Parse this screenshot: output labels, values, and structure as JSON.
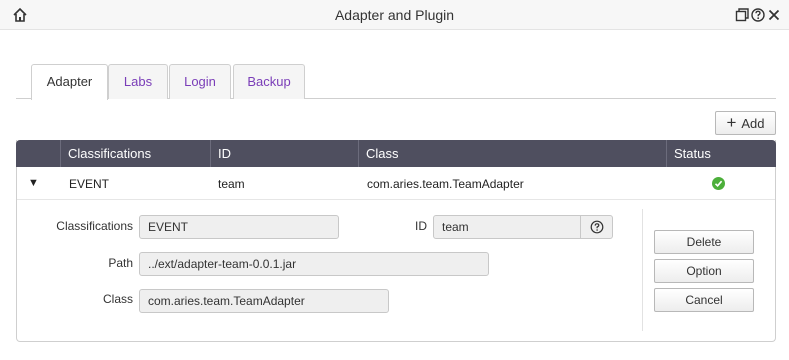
{
  "window": {
    "title": "Adapter and Plugin",
    "icons": [
      "home-icon",
      "restore-icon",
      "help-icon",
      "close-icon"
    ]
  },
  "tabs": [
    {
      "label": "Adapter",
      "active": true
    },
    {
      "label": "Labs",
      "active": false
    },
    {
      "label": "Login",
      "active": false
    },
    {
      "label": "Backup",
      "active": false
    }
  ],
  "toolbar": {
    "add_label": "Add"
  },
  "table": {
    "columns": [
      "Classifications",
      "ID",
      "Class",
      "Status"
    ],
    "rows": [
      {
        "classification": "EVENT",
        "id": "team",
        "class": "com.aries.team.TeamAdapter",
        "status": "ok",
        "expanded": true
      }
    ]
  },
  "detail": {
    "classifications_label": "Classifications",
    "classifications_value": "EVENT",
    "id_label": "ID",
    "id_value": "team",
    "path_label": "Path",
    "path_value": "../ext/adapter-team-0.0.1.jar",
    "class_label": "Class",
    "class_value": "com.aries.team.TeamAdapter",
    "buttons": {
      "delete": "Delete",
      "option": "Option",
      "cancel": "Cancel"
    }
  },
  "colors": {
    "header_bg": "#4f4f5f",
    "tab_inactive_text": "#7a3db8",
    "status_ok": "#4caf3a"
  }
}
